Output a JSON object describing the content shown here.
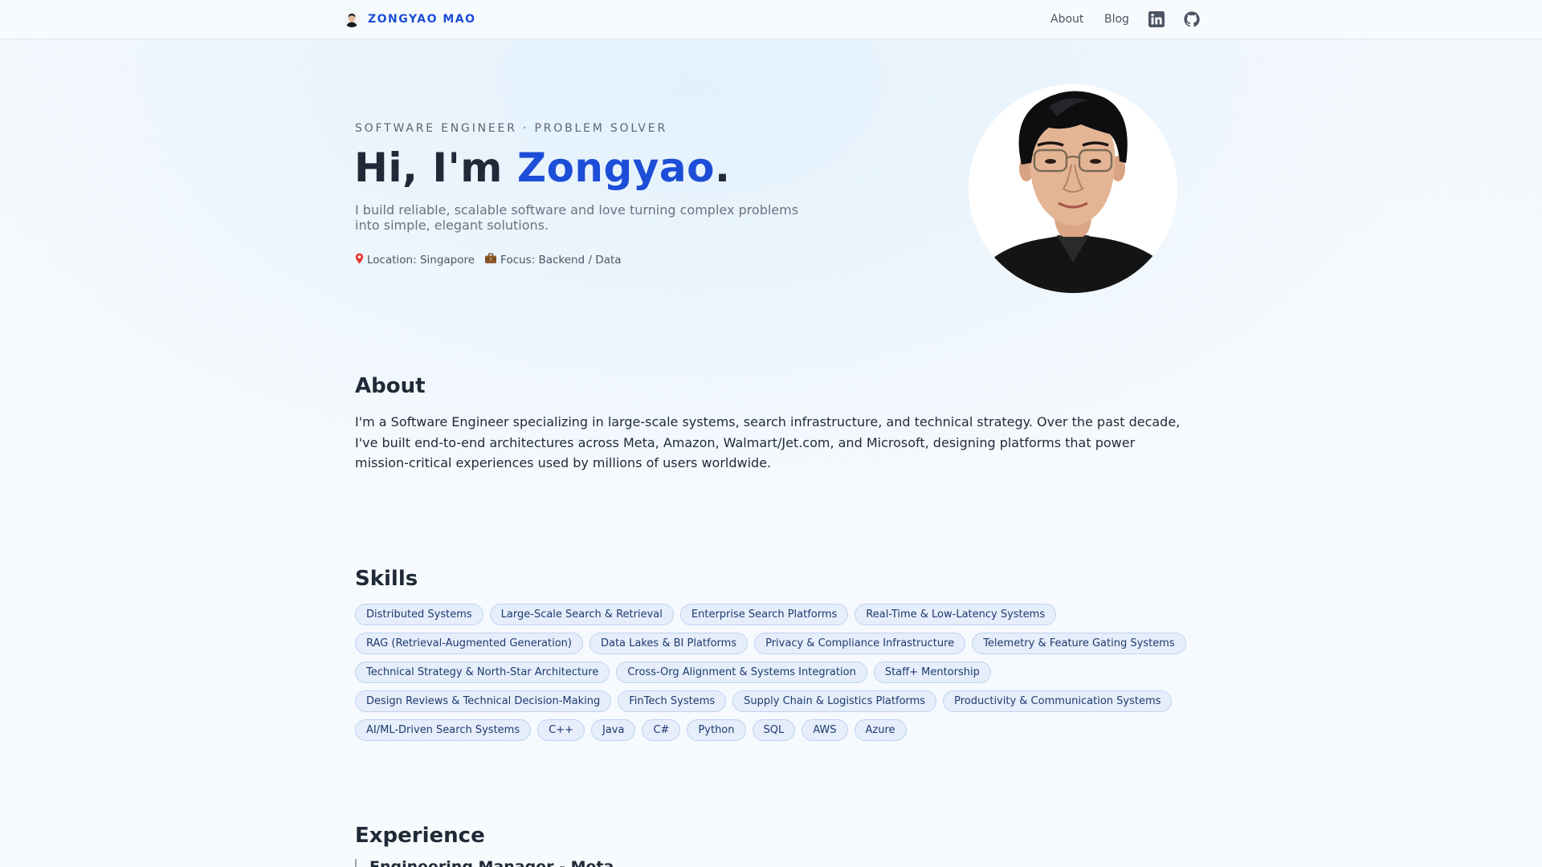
{
  "header": {
    "brand_name": "ZONGYAO MAO",
    "nav": [
      {
        "label": "About"
      },
      {
        "label": "Blog"
      }
    ],
    "icons": [
      "linkedin-icon",
      "github-icon"
    ]
  },
  "hero": {
    "eyebrow": "SOFTWARE ENGINEER · PROBLEM SOLVER",
    "title_prefix": "Hi, I'm ",
    "title_name": "Zongyao",
    "title_suffix": ".",
    "subtitle": "I build reliable, scalable software and love turning complex problems into simple, elegant solutions.",
    "location": "Location: Singapore",
    "focus": "Focus: Backend / Data"
  },
  "about": {
    "title": "About",
    "text": "I'm a Software Engineer specializing in large-scale systems, search infrastructure, and technical strategy. Over the past decade, I've built end-to-end architectures across Meta, Amazon, Walmart/Jet.com, and Microsoft, designing platforms that power mission-critical experiences used by millions of users worldwide."
  },
  "skills": {
    "title": "Skills",
    "rows": [
      [
        "Distributed Systems",
        "Large-Scale Search & Retrieval",
        "Enterprise Search Platforms",
        "Real-Time & Low-Latency Systems"
      ],
      [
        "RAG (Retrieval-Augmented Generation)",
        "Data Lakes & BI Platforms",
        "Privacy & Compliance Infrastructure",
        "Telemetry & Feature Gating Systems"
      ],
      [
        "Technical Strategy & North-Star Architecture",
        "Cross-Org Alignment & Systems Integration",
        "Staff+ Mentorship"
      ],
      [
        "Design Reviews & Technical Decision-Making",
        "FinTech Systems",
        "Supply Chain & Logistics Platforms",
        "Productivity & Communication Systems"
      ],
      [
        "AI/ML-Driven Search Systems",
        "C++",
        "Java",
        "C#",
        "Python",
        "SQL",
        "AWS",
        "Azure"
      ]
    ]
  },
  "experience": {
    "title": "Experience",
    "first_job": "Engineering Manager - Meta"
  },
  "colors": {
    "accent": "#1d4ed8",
    "chip_bg": "#e6eefb",
    "chip_border": "#bcd3f1"
  }
}
